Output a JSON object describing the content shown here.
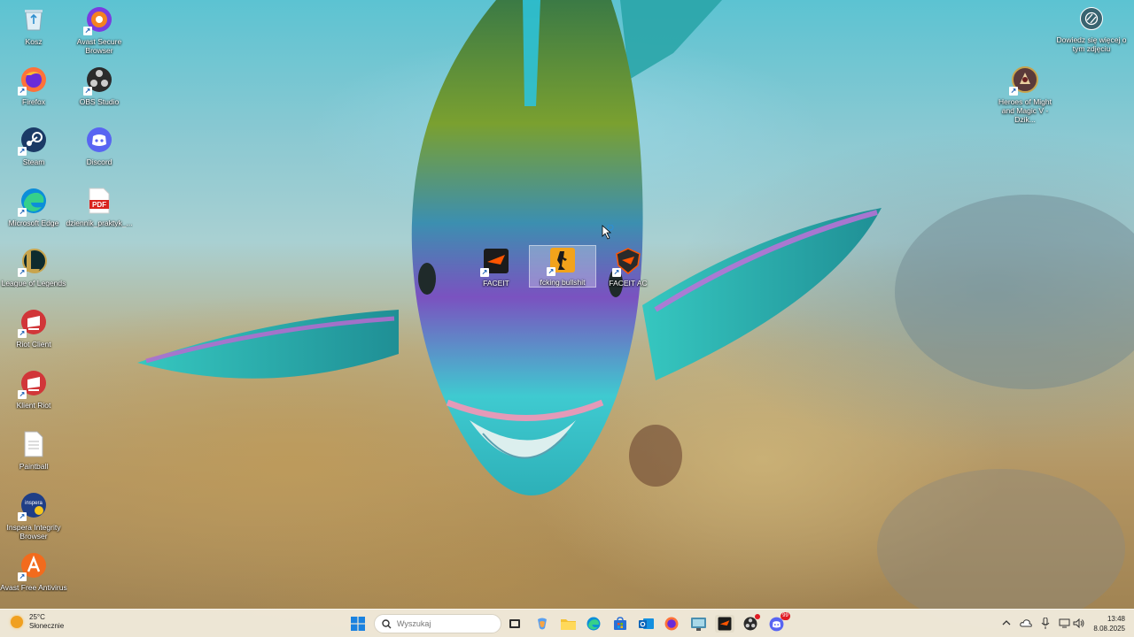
{
  "desktop": {
    "left_icons": [
      {
        "label": "Kosz",
        "icon": "recycle-bin-icon"
      },
      {
        "label": "Avast Secure Browser",
        "icon": "avast-secure-browser-icon"
      },
      {
        "label": "Firefox",
        "icon": "firefox-icon"
      },
      {
        "label": "OBS Studio",
        "icon": "obs-studio-icon"
      },
      {
        "label": "Steam",
        "icon": "steam-icon"
      },
      {
        "label": "Discord",
        "icon": "discord-icon"
      },
      {
        "label": "Microsoft Edge",
        "icon": "edge-icon"
      },
      {
        "label": "dziennik_praktyk_...",
        "icon": "pdf-file-icon"
      },
      {
        "label": "League of Legends",
        "icon": "league-of-legends-icon"
      },
      {
        "label": "Riot Client",
        "icon": "riot-client-icon"
      },
      {
        "label": "Klient Riot",
        "icon": "riot-client-icon"
      },
      {
        "label": "Paintball",
        "icon": "text-file-icon"
      },
      {
        "label": "Inspera Integrity Browser",
        "icon": "inspera-icon"
      },
      {
        "label": "Avast Free Antivirus",
        "icon": "avast-antivirus-icon"
      }
    ],
    "center_icons": [
      {
        "label": "FACEIT",
        "icon": "faceit-icon"
      },
      {
        "label": "fcking bullshit",
        "icon": "counter-strike-icon"
      },
      {
        "label": "FACEIT AC",
        "icon": "faceit-ac-icon"
      }
    ],
    "right_icons": [
      {
        "label": "Heroes of Might and Magic V - Dzik...",
        "icon": "heroes-icon"
      }
    ],
    "spotlight_label": "Dowiedz się więcej o tym zdjęciu",
    "pdf_badge": "PDF",
    "inspera_badge": "inspera"
  },
  "taskbar": {
    "weather": {
      "temperature": "25°C",
      "condition": "Słonecznie"
    },
    "search_placeholder": "Wyszukaj",
    "clock": {
      "time": "13:48",
      "date": "8.08.2025"
    },
    "discord_badge": "99",
    "pinned": [
      "start-icon",
      "task-view-icon",
      "copilot-icon",
      "file-explorer-icon",
      "edge-icon",
      "store-icon",
      "outlook-icon",
      "firefox-icon",
      "screen-app-icon",
      "faceit-icon",
      "obs-studio-icon",
      "discord-icon"
    ],
    "tray": [
      "chevron-up-icon",
      "onedrive-icon",
      "microphone-icon",
      "network-icon",
      "speaker-icon"
    ]
  }
}
